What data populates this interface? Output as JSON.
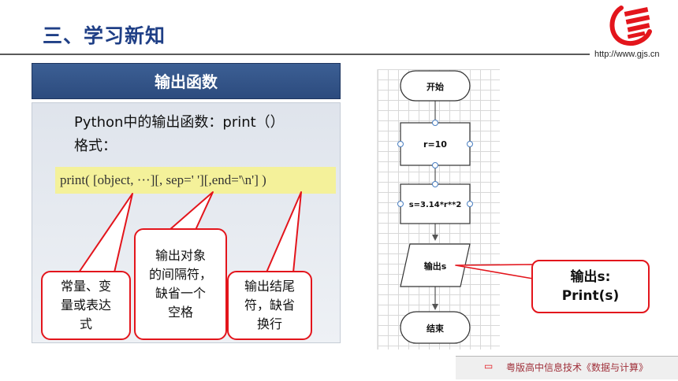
{
  "header": {
    "title": "三、学习新知",
    "url": "http://www.gjs.cn",
    "logo_icon": "gjs-logo-icon"
  },
  "section": {
    "banner": "输出函数"
  },
  "content": {
    "line1": "Python中的输出函数：print（）",
    "line2": "格式：",
    "syntax": "print( [object, ···][, sep='  '][,end='\\n'] )"
  },
  "notes": {
    "note1": [
      "常量、变",
      "量或表达",
      "式"
    ],
    "note2": [
      "输出对象",
      "的间隔符，",
      "缺省一个",
      "空格"
    ],
    "note3": [
      "输出结尾",
      "符，缺省",
      "换行"
    ]
  },
  "flowchart": {
    "start": "开始",
    "assign_r": "r=10",
    "assign_s": "s=3.14*r**2",
    "output": "输出s",
    "end": "结束"
  },
  "callout": {
    "line1": "输出s:",
    "line2": "Print(s)"
  },
  "footer": {
    "icon": "book-icon",
    "text": "粤版高中信息技术《数据与计算》"
  },
  "colors": {
    "title": "#1f3f86",
    "banner": "#2f4f82",
    "highlight": "#f4f19a",
    "accent_red": "#e3151c"
  }
}
